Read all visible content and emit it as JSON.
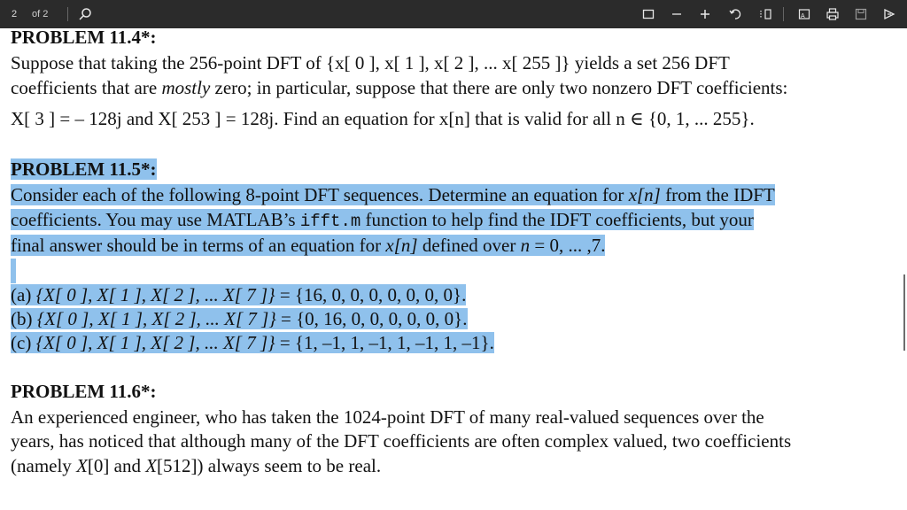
{
  "toolbar": {
    "page_number": "2",
    "page_of": "of 2",
    "icons": [
      "search-icon",
      "fit-page-icon",
      "zoom-out-icon",
      "zoom-in-icon",
      "rotate-icon",
      "page-view-icon",
      "read-aloud-icon",
      "print-icon",
      "save-icon",
      "draw-icon"
    ]
  },
  "problem_11_4": {
    "heading": "PROBLEM 11.4*:",
    "line1": "Suppose that taking the 256-point DFT of {x[ 0 ], x[ 1 ], x[ 2 ], ... x[ 255 ]} yields a set 256 DFT",
    "line2_a": "coefficients that are ",
    "line2_it": "mostly",
    "line2_b": " zero; in particular, suppose that there are only two nonzero DFT coefficients:",
    "line3": "X[ 3 ] = – 128j and X[ 253 ] = 128j. Find an equation for x[n] that is valid for all n ∈ {0, 1, ... 255}."
  },
  "problem_11_5": {
    "heading": "PROBLEM 11.5*:",
    "line1_a": "Consider each of the following 8-point DFT sequences.  Determine an equation for ",
    "line1_var": "x[n]",
    "line1_b": " from the IDFT",
    "line2_a": "coefficients.  You may use MATLAB’s ",
    "line2_code": "ifft.m",
    "line2_b": " function to help find the IDFT coefficients, but your",
    "line3_a": "final answer should be in terms of an equation for ",
    "line3_var": "x[n]",
    "line3_b": " defined over ",
    "line3_n": "n",
    "line3_c": " = 0, ... ,7.",
    "items": [
      {
        "label": "(a)",
        "lhs": "{X[ 0 ], X[ 1 ], X[ 2 ], ... X[ 7 ]}",
        "rhs": " = {16, 0, 0, 0, 0, 0, 0, 0}."
      },
      {
        "label": "(b)",
        "lhs": "{X[ 0 ], X[ 1 ], X[ 2 ], ... X[ 7 ]}",
        "rhs": " = {0, 16, 0, 0, 0, 0, 0, 0}."
      },
      {
        "label": "(c)",
        "lhs": "{X[ 0 ], X[ 1 ], X[ 2 ], ... X[ 7 ]}",
        "rhs": " = {1, –1, 1, –1, 1, –1, 1, –1}."
      }
    ]
  },
  "problem_11_6": {
    "heading": "PROBLEM 11.6*:",
    "line1": "An experienced engineer, who has taken the 1024-point DFT of many real-valued sequences over the",
    "line2": "years, has noticed that although many of the DFT coefficients are often complex valued, two coefficients",
    "line3_a": "(namely ",
    "line3_x0": "X",
    "line3_b": "[0] and ",
    "line3_x512": "X",
    "line3_c": "[512]) always seem to be real."
  }
}
